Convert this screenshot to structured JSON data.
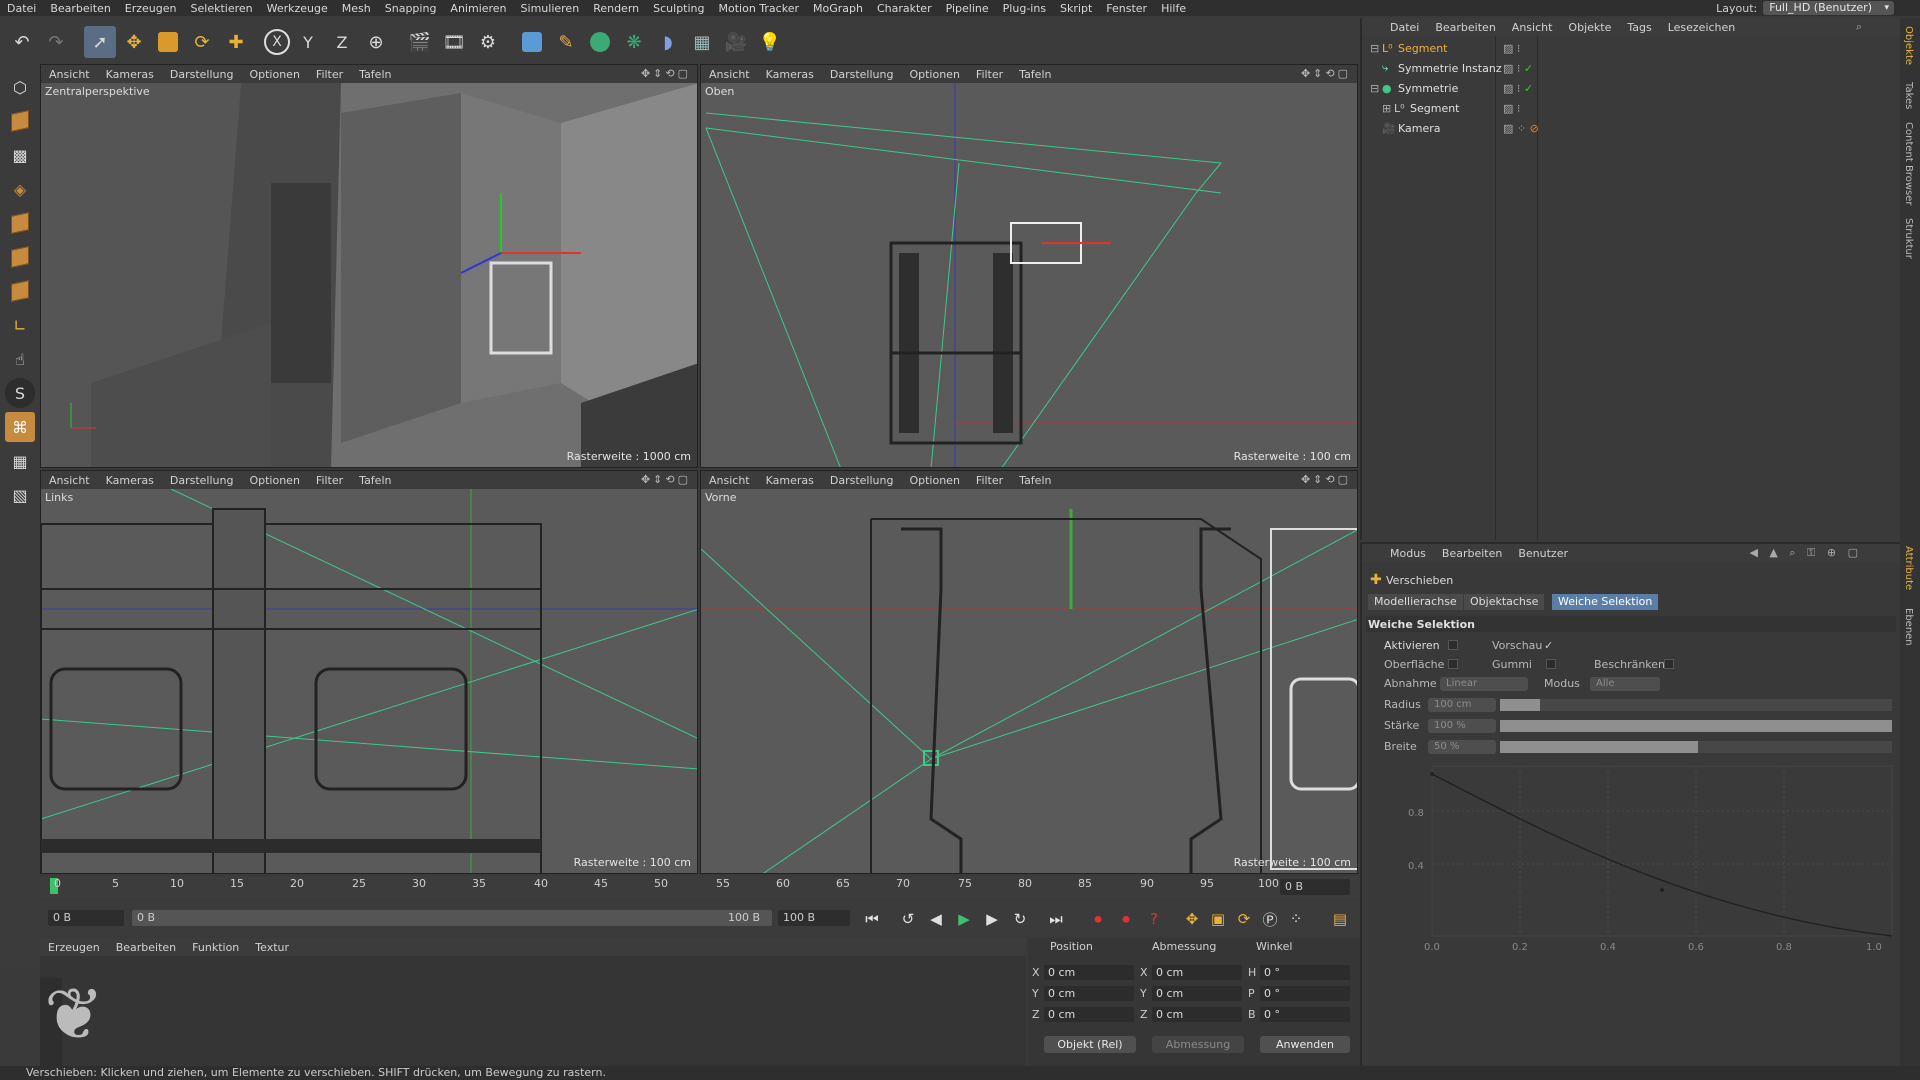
{
  "menubar": {
    "items": [
      "Datei",
      "Bearbeiten",
      "Erzeugen",
      "Selektieren",
      "Werkzeuge",
      "Mesh",
      "Snapping",
      "Animieren",
      "Simulieren",
      "Rendern",
      "Sculpting",
      "Motion Tracker",
      "MoGraph",
      "Charakter",
      "Pipeline",
      "Plug-ins",
      "Skript",
      "Fenster",
      "Hilfe"
    ],
    "layout_label": "Layout:",
    "layout_value": "Full_HD (Benutzer)"
  },
  "toolbar": {
    "icons": [
      "undo-icon",
      "redo-icon",
      "live-select-icon",
      "move-icon",
      "scale-icon",
      "rotate-icon",
      "add-icon",
      "x-axis-icon",
      "y-axis-icon",
      "z-axis-icon",
      "world-coord-icon",
      "render-view-icon",
      "render-picture-icon",
      "render-settings-icon",
      "cube-icon",
      "pen-icon",
      "subdivision-icon",
      "cloner-icon",
      "deformer-icon",
      "floor-icon",
      "camera-icon",
      "light-icon"
    ],
    "axis_x": "X",
    "axis_y": "Y",
    "axis_z": "Z"
  },
  "viewport_menu": [
    "Ansicht",
    "Kameras",
    "Darstellung",
    "Optionen",
    "Filter",
    "Tafeln"
  ],
  "viewports": [
    {
      "name": "Zentralperspektive",
      "grid": "Rasterweite : 1000 cm"
    },
    {
      "name": "Oben",
      "grid": "Rasterweite : 100 cm"
    },
    {
      "name": "Links",
      "grid": "Rasterweite : 100 cm"
    },
    {
      "name": "Vorne",
      "grid": "Rasterweite : 100 cm"
    }
  ],
  "timeline": {
    "ticks": [
      "0",
      "5",
      "10",
      "15",
      "20",
      "25",
      "30",
      "35",
      "40",
      "45",
      "50",
      "55",
      "60",
      "65",
      "70",
      "75",
      "80",
      "85",
      "90",
      "95",
      "100"
    ],
    "current_frame": "0 B",
    "start": "0 B",
    "range_start": "0 B",
    "range_end": "100 B",
    "end": "100 B"
  },
  "material_manager": {
    "menu": [
      "Erzeugen",
      "Bearbeiten",
      "Funktion",
      "Textur"
    ]
  },
  "coordinates": {
    "headers": [
      "Position",
      "Abmessung",
      "Winkel"
    ],
    "rows": [
      {
        "axis": "X",
        "pos": "0 cm",
        "size_axis": "X",
        "size": "0 cm",
        "rot_axis": "H",
        "rot": "0 °"
      },
      {
        "axis": "Y",
        "pos": "0 cm",
        "size_axis": "Y",
        "size": "0 cm",
        "rot_axis": "P",
        "rot": "0 °"
      },
      {
        "axis": "Z",
        "pos": "0 cm",
        "size_axis": "Z",
        "size": "0 cm",
        "rot_axis": "B",
        "rot": "0 °"
      }
    ],
    "mode": "Objekt (Rel)",
    "size_mode": "Abmessung",
    "apply": "Anwenden"
  },
  "object_manager": {
    "menu": [
      "Datei",
      "Bearbeiten",
      "Ansicht",
      "Objekte",
      "Tags",
      "Lesezeichen"
    ],
    "objects": [
      {
        "name": "Segment",
        "highlight": true
      },
      {
        "name": "Symmetrie Instanz",
        "highlight": false
      },
      {
        "name": "Symmetrie",
        "highlight": false
      },
      {
        "name": "Segment",
        "highlight": false
      },
      {
        "name": "Kamera",
        "highlight": false
      }
    ]
  },
  "attributes": {
    "menu": [
      "Modus",
      "Bearbeiten",
      "Benutzer"
    ],
    "tool": "Verschieben",
    "tabs": [
      "Modellierachse",
      "Objektachse",
      "Weiche Selektion"
    ],
    "section": "Weiche Selektion",
    "aktivieren": "Aktivieren",
    "vorschau": "Vorschau",
    "oberflaeche": "Oberfläche",
    "gummi": "Gummi",
    "beschraenken": "Beschränken",
    "abnahme": "Abnahme",
    "abnahme_val": "Linear",
    "modus": "Modus",
    "modus_val": "Alle",
    "radius": "Radius",
    "radius_val": "100 cm",
    "staerke": "Stärke",
    "staerke_val": "100 %",
    "breite": "Breite",
    "breite_val": "50 %",
    "graph_y": [
      "0.8",
      "0.4"
    ],
    "graph_x": [
      "0.0",
      "0.2",
      "0.4",
      "0.6",
      "0.8",
      "1.0"
    ]
  },
  "right_strip": [
    "Objekte",
    "Takes",
    "Content Browser",
    "Struktur",
    "Attribute",
    "Ebenen"
  ],
  "status": "Verschieben: Klicken und ziehen, um Elemente zu verschieben. SHIFT drücken, um Bewegung zu rastern.",
  "colors": {
    "accent": "#5b7ea8",
    "highlight": "#f2b13a",
    "viewport_bg": "#5a5a5a"
  }
}
